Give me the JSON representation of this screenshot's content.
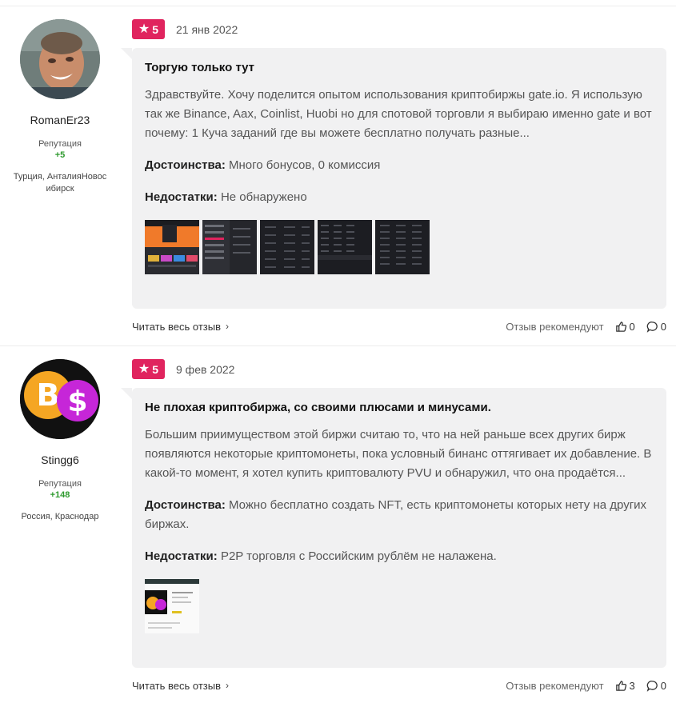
{
  "reviews": [
    {
      "author": {
        "name": "RomanEr23",
        "reputation_label": "Репутация",
        "reputation_value": "+5",
        "location": "Турция, АнталияНовосибирск"
      },
      "rating": "5",
      "date": "21 янв 2022",
      "title": "Торгую только тут",
      "text": "Здравствуйте. Хочу поделится опытом использования криптобиржы gate.io. Я использую так же Binance, Aax, Coinlist, Huobi но для спотовой торговли я выбираю именно gate и вот почему: 1 Куча заданий где вы можете бесплатно получать разные...",
      "pros_label": "Достоинства:",
      "pros": "Много бонусов, 0 комиссия",
      "cons_label": "Недостатки:",
      "cons": "Не обнаружено",
      "read_more": "Читать весь отзыв",
      "recommends": "Отзыв рекомендуют",
      "likes": "0",
      "comments": "0"
    },
    {
      "author": {
        "name": "Stingg6",
        "reputation_label": "Репутация",
        "reputation_value": "+148",
        "location": "Россия, Краснодар"
      },
      "rating": "5",
      "date": "9 фев 2022",
      "title": "Не плохая криптобиржа, со своими плюсами и минусами.",
      "text": "Большим приимуществом этой биржи считаю то, что на ней раньше всех других бирж появляются некоторые криптомонеты, пока условный бинанс оттягивает их добавление. В какой-то момент, я хотел купить криптовалюту PVU и обнаружил, что она продаётся...",
      "pros_label": "Достоинства:",
      "pros": "Можно бесплатно создать NFT, есть криптомонеты которых нету на других биржах.",
      "cons_label": "Недостатки:",
      "cons": "P2P торговля с Российским рублём не налажена.",
      "read_more": "Читать весь отзыв",
      "recommends": "Отзыв рекомендуют",
      "likes": "3",
      "comments": "0"
    }
  ],
  "icons": {
    "star": "star-icon",
    "chevron": "chevron-right-icon",
    "like": "thumbs-up-icon",
    "comment": "comment-icon"
  },
  "colors": {
    "badge": "#e0245e",
    "bubble": "#f1f1f2",
    "reputation": "#2e9a2e"
  }
}
